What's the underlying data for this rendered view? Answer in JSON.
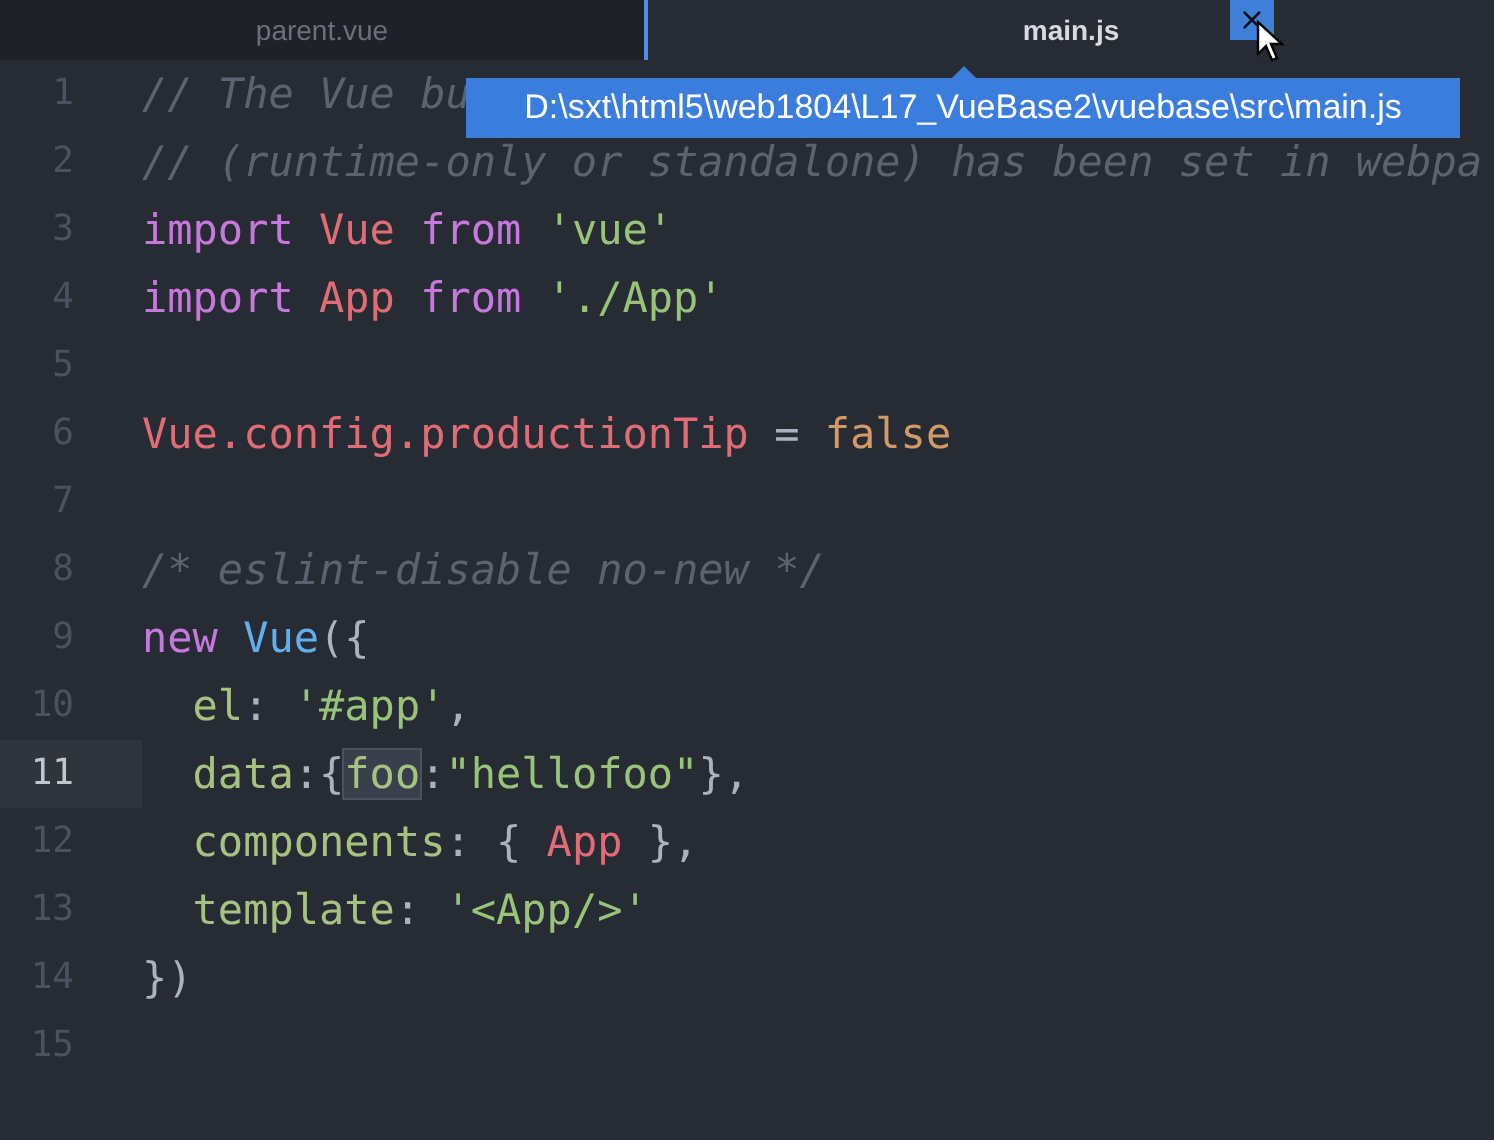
{
  "tabs": [
    {
      "label": "parent.vue",
      "selected": false
    },
    {
      "label": "main.js",
      "selected": true,
      "close": "×"
    }
  ],
  "tooltip": "D:\\sxt\\html5\\web1804\\L17_VueBase2\\vuebase\\src\\main.js",
  "lines": [
    {
      "number": "1",
      "current": false,
      "tokens": [
        {
          "kind": "comment",
          "text": "// The Vue bu"
        }
      ]
    },
    {
      "number": "2",
      "current": false,
      "tokens": [
        {
          "kind": "comment",
          "text": "// (runtime-only or standalone) has been set in webpa"
        }
      ]
    },
    {
      "number": "3",
      "current": false,
      "tokens": [
        {
          "kind": "keyword",
          "text": "import "
        },
        {
          "kind": "class",
          "text": "Vue "
        },
        {
          "kind": "keyword",
          "text": "from "
        },
        {
          "kind": "string",
          "text": "'vue'"
        }
      ]
    },
    {
      "number": "4",
      "current": false,
      "tokens": [
        {
          "kind": "keyword",
          "text": "import "
        },
        {
          "kind": "class",
          "text": "App "
        },
        {
          "kind": "keyword",
          "text": "from "
        },
        {
          "kind": "string",
          "text": "'./App'"
        }
      ]
    },
    {
      "number": "5",
      "current": false
    },
    {
      "number": "6",
      "current": false,
      "tokens": [
        {
          "kind": "class",
          "text": "Vue.config.productionTip "
        },
        {
          "kind": "punct",
          "text": "= "
        },
        {
          "kind": "boolean",
          "text": "false"
        }
      ]
    },
    {
      "number": "7",
      "current": false
    },
    {
      "number": "8",
      "current": false,
      "tokens": [
        {
          "kind": "comment",
          "text": "/* eslint-disable no-new */"
        }
      ]
    },
    {
      "number": "9",
      "current": false,
      "tokens": [
        {
          "kind": "keyword",
          "text": "new "
        },
        {
          "kind": "func",
          "text": "Vue"
        },
        {
          "kind": "punct",
          "text": "({"
        }
      ]
    },
    {
      "number": "10",
      "current": false,
      "tokens": [
        {
          "kind": "property",
          "text": "  el"
        },
        {
          "kind": "punct",
          "text": ": "
        },
        {
          "kind": "string",
          "text": "'#app'"
        },
        {
          "kind": "punct",
          "text": ","
        }
      ]
    },
    {
      "number": "11",
      "current": true,
      "tokens": [
        {
          "kind": "property",
          "text": "  data"
        },
        {
          "kind": "punct",
          "text": ":{"
        },
        {
          "kind": "match",
          "text": "foo"
        },
        {
          "kind": "punct",
          "text": ":"
        },
        {
          "kind": "string",
          "text": "\"hellofoo\""
        },
        {
          "kind": "punct",
          "text": "},"
        }
      ]
    },
    {
      "number": "12",
      "current": false,
      "tokens": [
        {
          "kind": "property",
          "text": "  components"
        },
        {
          "kind": "punct",
          "text": ": { "
        },
        {
          "kind": "class",
          "text": "App"
        },
        {
          "kind": "punct",
          "text": " },"
        }
      ]
    },
    {
      "number": "13",
      "current": false,
      "tokens": [
        {
          "kind": "property",
          "text": "  template"
        },
        {
          "kind": "punct",
          "text": ": "
        },
        {
          "kind": "string",
          "text": "'<App/>'"
        }
      ]
    },
    {
      "number": "14",
      "current": false,
      "tokens": [
        {
          "kind": "punct",
          "text": "})"
        }
      ]
    },
    {
      "number": "15",
      "current": false
    }
  ]
}
